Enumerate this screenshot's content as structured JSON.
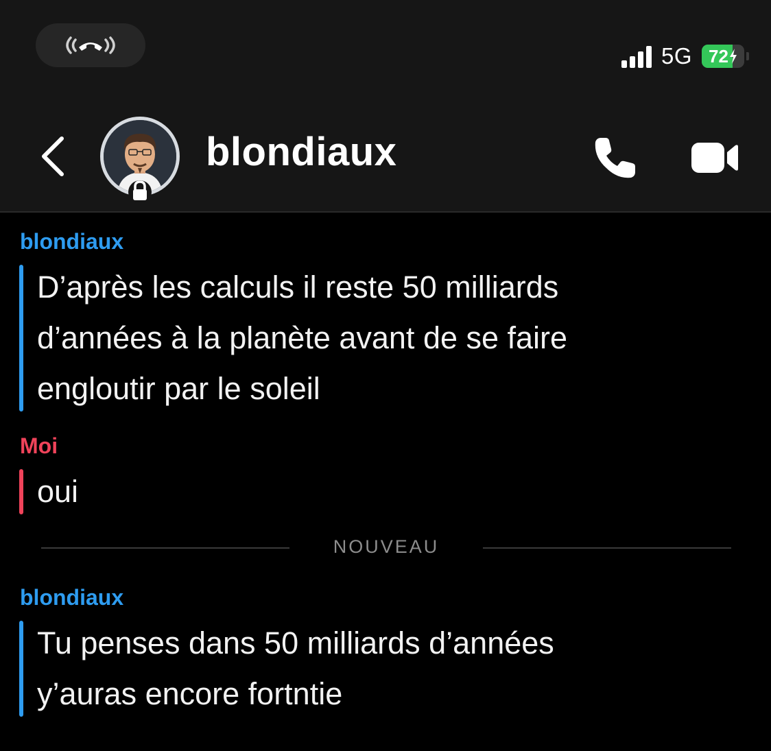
{
  "status_bar": {
    "network": "5G",
    "battery_level": "72",
    "battery_fraction": 0.72,
    "battery_color": "#34c759",
    "call_icon": "phone-call-icon",
    "signal_bars": 4
  },
  "header": {
    "contact_name": "blondiaux",
    "back_icon": "chevron-left-icon",
    "audio_call_icon": "phone-icon",
    "video_call_icon": "video-camera-icon",
    "avatar_badge_icon": "lock-icon"
  },
  "messages": [
    {
      "sender": "blondiaux",
      "text": "D’après les calculs il reste 50 milliards d’années à la planète avant de se faire engloutir par le soleil"
    },
    {
      "sender": "Moi",
      "text": "oui"
    },
    {
      "sender": "blondiaux",
      "text": "Tu penses dans 50 milliards d’années y’auras encore fortntie"
    }
  ],
  "divider_label": "NOUVEAU",
  "colors": {
    "them": "#2e9cf0",
    "me": "#f0435a",
    "background": "#000000",
    "header_background": "#161616"
  }
}
